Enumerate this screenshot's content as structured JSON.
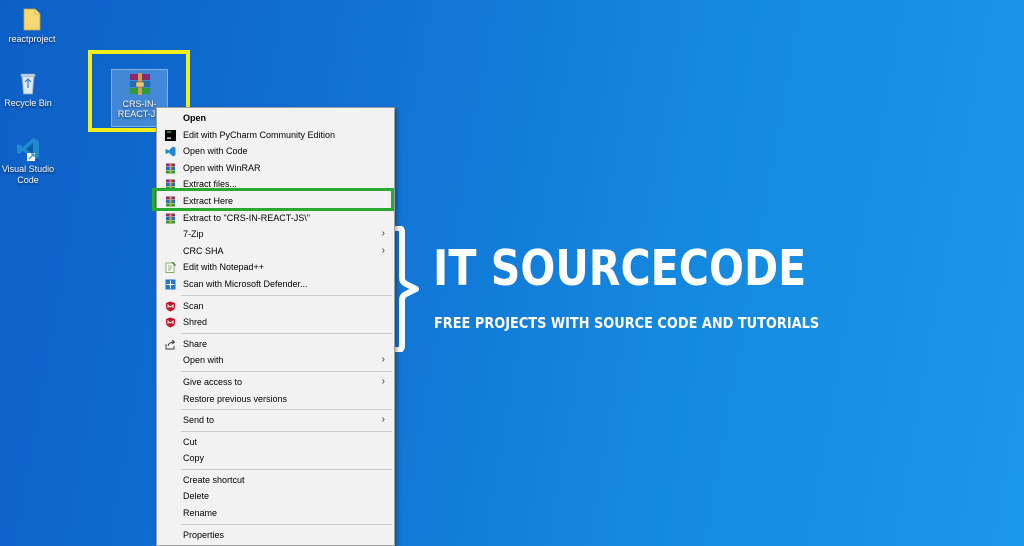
{
  "desktop": {
    "icons": [
      {
        "label": "reactproject",
        "icon": "folder-icon"
      },
      {
        "label": "Recycle Bin",
        "icon": "recycle-bin-icon"
      },
      {
        "label": "Visual Studio Code",
        "icon": "vscode-icon"
      },
      {
        "label": "CRS-IN-REACT-JS",
        "icon": "winrar-archive-icon",
        "selected": true
      }
    ]
  },
  "brand": {
    "title": "IT SOURCECODE",
    "tagline": "FREE PROJECTS WITH SOURCE CODE AND TUTORIALS"
  },
  "context_menu": {
    "groups": [
      [
        {
          "label": "Open",
          "bold": true
        },
        {
          "label": "Edit with PyCharm Community Edition",
          "icon": "pycharm-icon"
        },
        {
          "label": "Open with Code",
          "icon": "vscode-icon"
        },
        {
          "label": "Open with WinRAR",
          "icon": "winrar-icon"
        },
        {
          "label": "Extract files...",
          "icon": "winrar-icon"
        },
        {
          "label": "Extract Here",
          "icon": "winrar-icon",
          "highlighted": true
        },
        {
          "label": "Extract to \"CRS-IN-REACT-JS\\\"",
          "icon": "winrar-icon"
        },
        {
          "label": "7-Zip",
          "submenu": true
        },
        {
          "label": "CRC SHA",
          "submenu": true
        },
        {
          "label": "Edit with Notepad++",
          "icon": "notepadpp-icon"
        },
        {
          "label": "Scan with Microsoft Defender...",
          "icon": "defender-icon"
        }
      ],
      [
        {
          "label": "Scan",
          "icon": "mcafee-icon"
        },
        {
          "label": "Shred",
          "icon": "mcafee-icon"
        }
      ],
      [
        {
          "label": "Share",
          "icon": "share-icon"
        },
        {
          "label": "Open with",
          "submenu": true
        }
      ],
      [
        {
          "label": "Give access to",
          "submenu": true
        },
        {
          "label": "Restore previous versions"
        }
      ],
      [
        {
          "label": "Send to",
          "submenu": true
        }
      ],
      [
        {
          "label": "Cut"
        },
        {
          "label": "Copy"
        }
      ],
      [
        {
          "label": "Create shortcut"
        },
        {
          "label": "Delete"
        },
        {
          "label": "Rename"
        }
      ],
      [
        {
          "label": "Properties"
        }
      ]
    ]
  },
  "colors": {
    "highlight_selected_file": "#f3ee1a",
    "highlight_menu_item": "#2aa834"
  }
}
